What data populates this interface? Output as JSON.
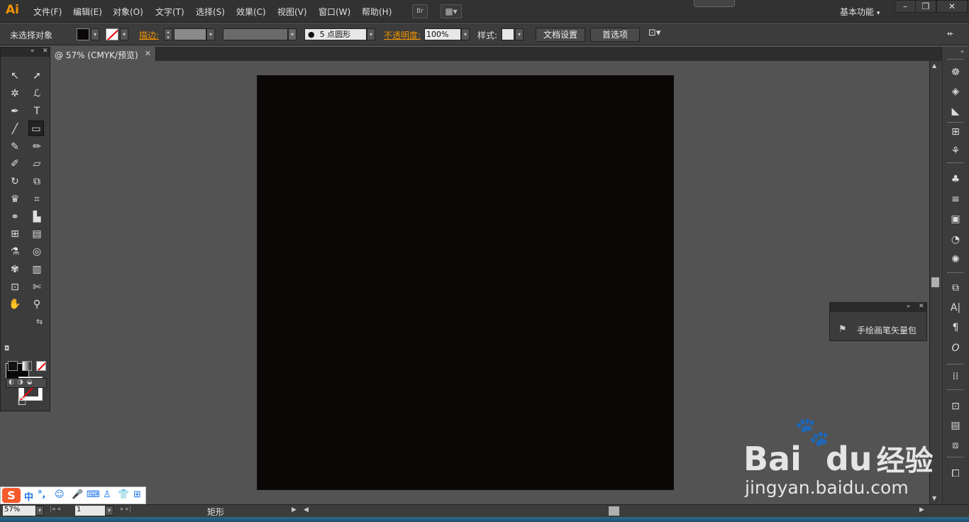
{
  "app": {
    "logo": "Ai"
  },
  "menu": [
    {
      "label": "文件(F)"
    },
    {
      "label": "编辑(E)"
    },
    {
      "label": "对象(O)"
    },
    {
      "label": "文字(T)"
    },
    {
      "label": "选择(S)"
    },
    {
      "label": "效果(C)"
    },
    {
      "label": "视图(V)"
    },
    {
      "label": "窗口(W)"
    },
    {
      "label": "帮助(H)"
    }
  ],
  "menubar": {
    "bridge_label": "Br",
    "workspace": "基本功能"
  },
  "control": {
    "selection": "未选择对象",
    "stroke_label": "描边:",
    "brush_size": "5",
    "brush_shape": "点圆形",
    "opacity_label": "不透明度:",
    "opacity_value": "100%",
    "style_label": "样式:",
    "doc_setup": "文档设置",
    "preferences": "首选项"
  },
  "document": {
    "tab_title": "@ 57% (CMYK/预览)"
  },
  "panel": {
    "brush_item": "手绘画笔矢量包"
  },
  "status": {
    "zoom": "57%",
    "artboard": "1",
    "tool": "矩形"
  },
  "ime": {
    "mode": "中",
    "punct": "°,"
  },
  "watermark": {
    "brand": "Bai",
    "brand2": "du",
    "product": "经验",
    "url": "jingyan.baidu.com"
  },
  "colors": {
    "accent": "#f29400",
    "artboard": "#0a0606",
    "canvas": "#535353"
  }
}
